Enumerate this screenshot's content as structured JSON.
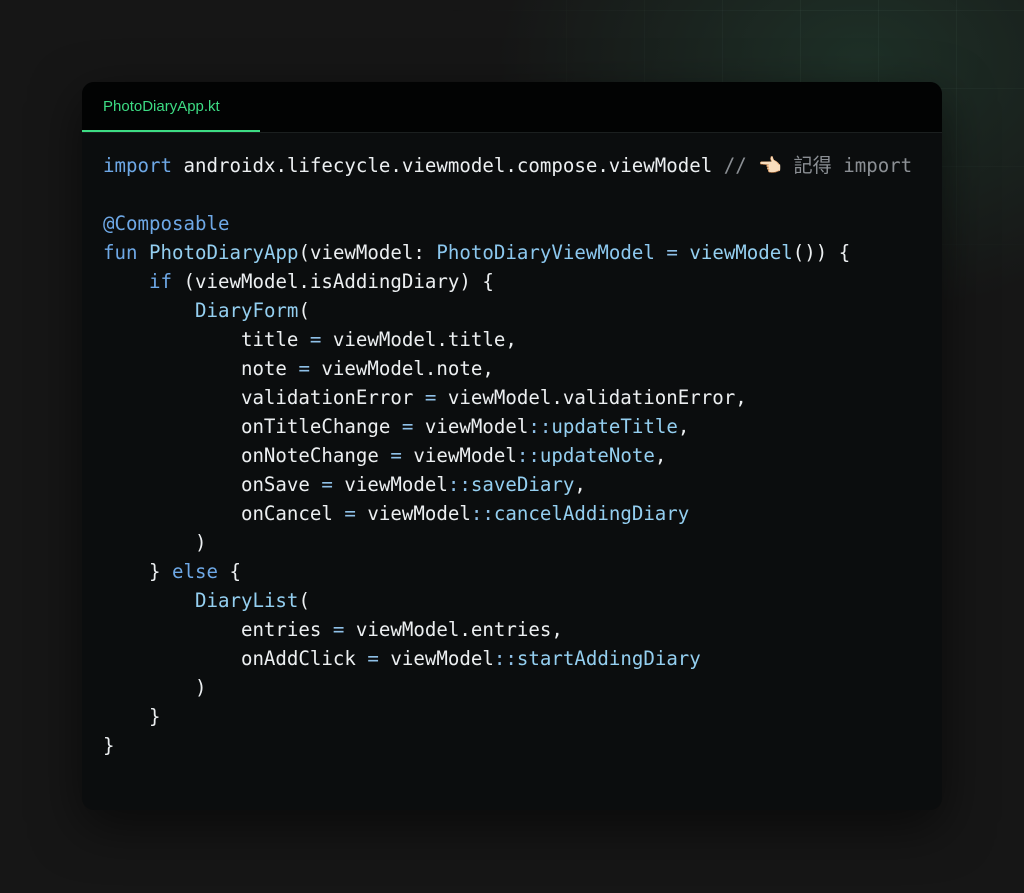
{
  "tab": {
    "label": "PhotoDiaryApp.kt"
  },
  "code": {
    "lines": [
      [
        {
          "t": "import",
          "k": "kw"
        },
        {
          "t": " androidx.lifecycle.viewmodel.compose.viewModel ",
          "k": "pl"
        },
        {
          "t": "// 👈🏻 記得 import",
          "k": "cm"
        }
      ],
      [],
      [
        {
          "t": "@Composable",
          "k": "kw"
        }
      ],
      [
        {
          "t": "fun",
          "k": "kw"
        },
        {
          "t": " ",
          "k": "pl"
        },
        {
          "t": "PhotoDiaryApp",
          "k": "fn"
        },
        {
          "t": "(viewModel: ",
          "k": "pl"
        },
        {
          "t": "PhotoDiaryViewModel",
          "k": "ty"
        },
        {
          "t": " ",
          "k": "pl"
        },
        {
          "t": "=",
          "k": "op"
        },
        {
          "t": " ",
          "k": "pl"
        },
        {
          "t": "viewModel",
          "k": "fn"
        },
        {
          "t": "()) {",
          "k": "pl"
        }
      ],
      [
        {
          "t": "    ",
          "k": "pl"
        },
        {
          "t": "if",
          "k": "kw"
        },
        {
          "t": " (viewModel.isAddingDiary) {",
          "k": "pl"
        }
      ],
      [
        {
          "t": "        ",
          "k": "pl"
        },
        {
          "t": "DiaryForm",
          "k": "fn"
        },
        {
          "t": "(",
          "k": "pl"
        }
      ],
      [
        {
          "t": "            title ",
          "k": "pl"
        },
        {
          "t": "=",
          "k": "op"
        },
        {
          "t": " viewModel.title,",
          "k": "pl"
        }
      ],
      [
        {
          "t": "            note ",
          "k": "pl"
        },
        {
          "t": "=",
          "k": "op"
        },
        {
          "t": " viewModel.note,",
          "k": "pl"
        }
      ],
      [
        {
          "t": "            validationError ",
          "k": "pl"
        },
        {
          "t": "=",
          "k": "op"
        },
        {
          "t": " viewModel.validationError,",
          "k": "pl"
        }
      ],
      [
        {
          "t": "            onTitleChange ",
          "k": "pl"
        },
        {
          "t": "=",
          "k": "op"
        },
        {
          "t": " viewModel",
          "k": "pl"
        },
        {
          "t": "::",
          "k": "op"
        },
        {
          "t": "updateTitle",
          "k": "fn"
        },
        {
          "t": ",",
          "k": "pl"
        }
      ],
      [
        {
          "t": "            onNoteChange ",
          "k": "pl"
        },
        {
          "t": "=",
          "k": "op"
        },
        {
          "t": " viewModel",
          "k": "pl"
        },
        {
          "t": "::",
          "k": "op"
        },
        {
          "t": "updateNote",
          "k": "fn"
        },
        {
          "t": ",",
          "k": "pl"
        }
      ],
      [
        {
          "t": "            onSave ",
          "k": "pl"
        },
        {
          "t": "=",
          "k": "op"
        },
        {
          "t": " viewModel",
          "k": "pl"
        },
        {
          "t": "::",
          "k": "op"
        },
        {
          "t": "saveDiary",
          "k": "fn"
        },
        {
          "t": ",",
          "k": "pl"
        }
      ],
      [
        {
          "t": "            onCancel ",
          "k": "pl"
        },
        {
          "t": "=",
          "k": "op"
        },
        {
          "t": " viewModel",
          "k": "pl"
        },
        {
          "t": "::",
          "k": "op"
        },
        {
          "t": "cancelAddingDiary",
          "k": "fn"
        }
      ],
      [
        {
          "t": "        )",
          "k": "pl"
        }
      ],
      [
        {
          "t": "    } ",
          "k": "pl"
        },
        {
          "t": "else",
          "k": "kw"
        },
        {
          "t": " {",
          "k": "pl"
        }
      ],
      [
        {
          "t": "        ",
          "k": "pl"
        },
        {
          "t": "DiaryList",
          "k": "fn"
        },
        {
          "t": "(",
          "k": "pl"
        }
      ],
      [
        {
          "t": "            entries ",
          "k": "pl"
        },
        {
          "t": "=",
          "k": "op"
        },
        {
          "t": " viewModel.entries,",
          "k": "pl"
        }
      ],
      [
        {
          "t": "            onAddClick ",
          "k": "pl"
        },
        {
          "t": "=",
          "k": "op"
        },
        {
          "t": " viewModel",
          "k": "pl"
        },
        {
          "t": "::",
          "k": "op"
        },
        {
          "t": "startAddingDiary",
          "k": "fn"
        }
      ],
      [
        {
          "t": "        )",
          "k": "pl"
        }
      ],
      [
        {
          "t": "    }",
          "k": "pl"
        }
      ],
      [
        {
          "t": "}",
          "k": "pl"
        }
      ]
    ]
  },
  "colors": {
    "accent": "#3ddc84",
    "keyword": "#6ea8e6",
    "function": "#94cff0",
    "comment": "#8b8f94",
    "text": "#eceff1",
    "panel": "#0b0d0e",
    "tabbar": "#020303",
    "background": "#161616"
  }
}
